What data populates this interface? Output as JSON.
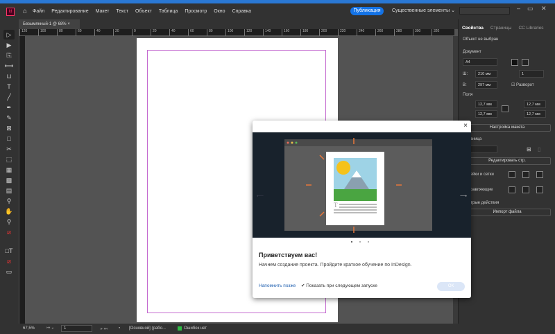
{
  "app": {
    "logo": "Id",
    "menu": [
      "Файл",
      "Редактирование",
      "Макет",
      "Текст",
      "Объект",
      "Таблица",
      "Просмотр",
      "Окно",
      "Справка"
    ],
    "publish": "Публикация",
    "workspace": "Существенные элементы"
  },
  "document_tab": {
    "title": "Безымянный-1 @ 68%",
    "close": "×"
  },
  "ruler": [
    "120",
    "100",
    "80",
    "60",
    "40",
    "20",
    "0",
    "20",
    "40",
    "60",
    "80",
    "100",
    "120",
    "140",
    "160",
    "180",
    "200",
    "220",
    "240",
    "260",
    "280",
    "300",
    "320"
  ],
  "panel": {
    "tabs": [
      "Свойства",
      "Страницы",
      "CC Libraries"
    ],
    "no_selection": "Объект не выбран",
    "document_label": "Документ",
    "preset": "A4",
    "width_label": "Ш:",
    "width": "210 мм",
    "height_label": "В:",
    "height": "297 мм",
    "pages": "1",
    "facing_pages": "Разворот",
    "margins_label": "Поля",
    "margin_top": "12,7 мм",
    "margin_bottom": "12,7 мм",
    "margin_left": "12,7 мм",
    "margin_right": "12,7 мм",
    "layout_button": "Настройка макета",
    "page_label": "Страница",
    "edit_page_button": "Редактировать стр.",
    "rulers_label": "Линейки и сетки",
    "guides_label": "Направляющие",
    "quick_actions_label": "Быстрые действия",
    "import_button": "Импорт файла"
  },
  "status": {
    "zoom": "67,5%",
    "page": "1",
    "style": "[Основной] (рабо...",
    "errors": "Ошибок нет"
  },
  "dialog": {
    "title": "Приветствуем вас!",
    "text": "Начнем создание проекта. Пройдите краткое обучение по InDesign.",
    "remind_later": "Напомнить позже",
    "show_next": "Показать при следующем запуске",
    "ok": "ОК",
    "close": "×"
  },
  "colors": {
    "accent": "#1473e6",
    "margin_guide": "#c46ad0",
    "hero_bg": "#18222c",
    "orange": "#e8773a"
  }
}
